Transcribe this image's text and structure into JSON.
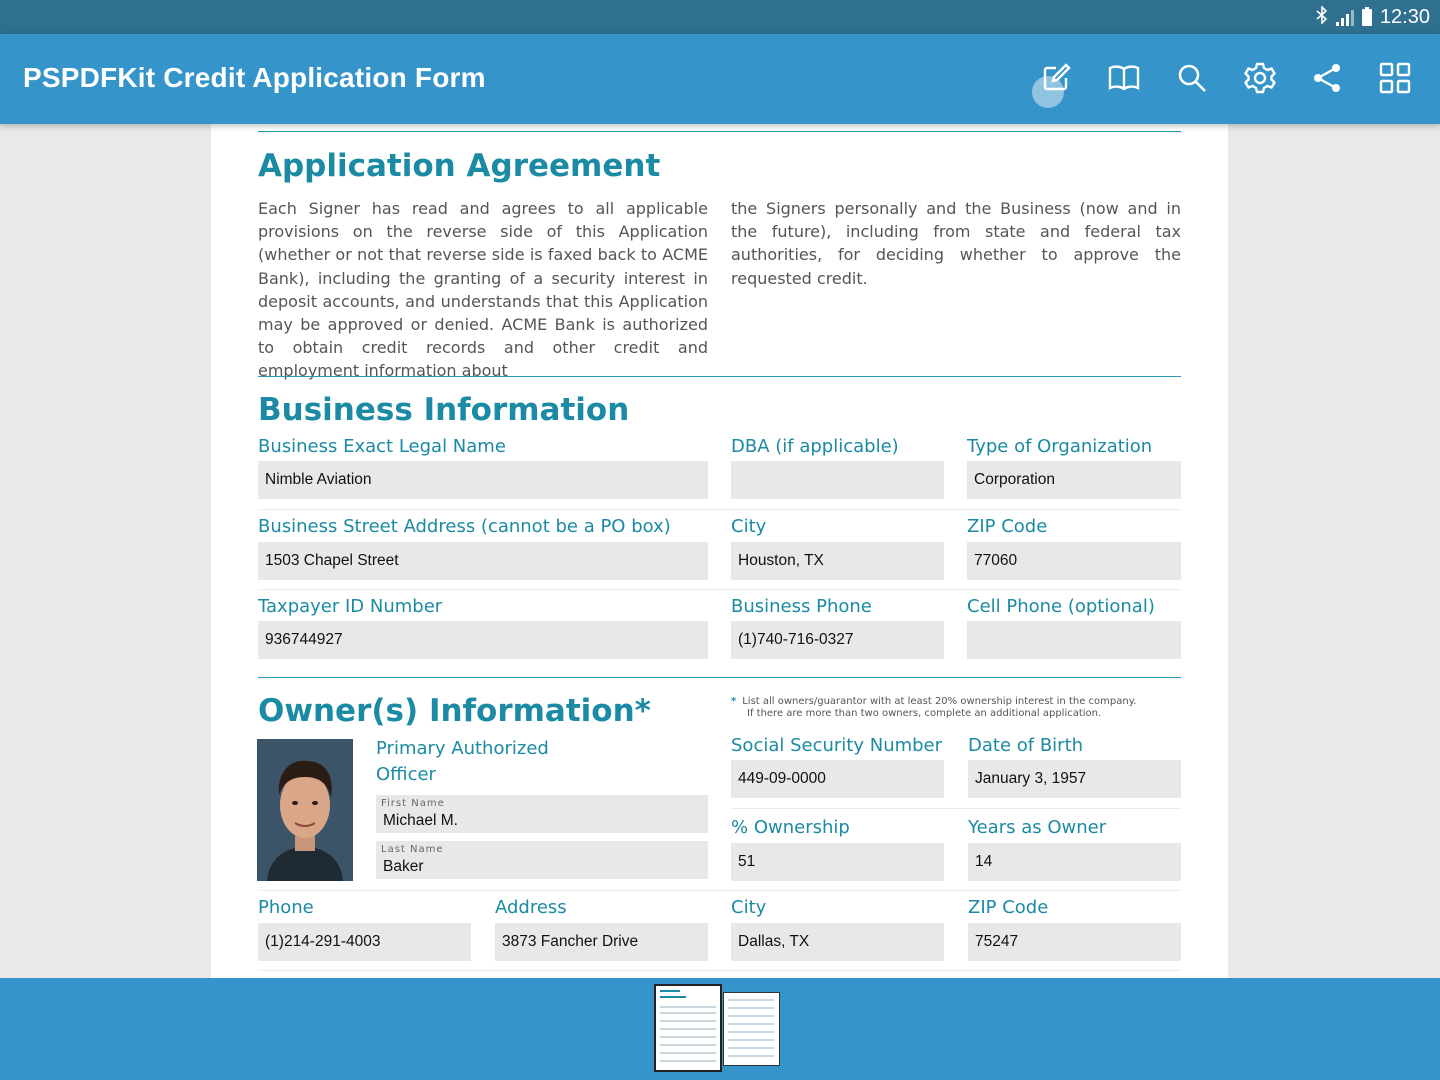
{
  "status_bar": {
    "time": "12:30",
    "icons": [
      "bluetooth-icon",
      "signal-icon",
      "battery-icon"
    ]
  },
  "app_bar": {
    "title": "PSPDFKit Credit Application Form",
    "actions": [
      "annotate-icon",
      "book-outline-icon",
      "search-icon",
      "settings-icon",
      "share-icon",
      "grid-view-icon"
    ]
  },
  "agreement": {
    "heading": "Application Agreement",
    "left_text": "Each Signer has read and agrees to all applicable provisions on the reverse side of this Application (whether or not that reverse side is faxed back to ACME Bank), including the granting of a security interest in deposit accounts, and understands that this Application may be approved or denied. ACME Bank is authorized to obtain credit records and other credit and employment information about",
    "right_text": "the Signers personally and the Business (now and in the future), including from state and federal tax authorities, for deciding whether to approve the requested credit."
  },
  "business": {
    "heading": "Business Information",
    "legal_name_label": "Business Exact Legal Name",
    "legal_name": "Nimble Aviation",
    "dba_label": "DBA (if applicable)",
    "dba": "",
    "org_type_label": "Type of Organization",
    "org_type": "Corporation",
    "address_label": "Business Street Address (cannot be a PO box)",
    "address": "1503 Chapel Street",
    "city_label": "City",
    "city": "Houston, TX",
    "zip_label": "ZIP Code",
    "zip": "77060",
    "taxpayer_label": "Taxpayer ID Number",
    "taxpayer": "936744927",
    "phone_label": "Business Phone",
    "phone": "(1)740-716-0327",
    "cell_label": "Cell Phone (optional)",
    "cell": ""
  },
  "owner": {
    "heading": "Owner(s) Information*",
    "note_star": "*",
    "note_line1": "List all owners/guarantor with at least 20% ownership interest in the company.",
    "note_line2": "If there are more than two owners, complete an additional application.",
    "officer_label_1": "Primary Authorized",
    "officer_label_2": "Officer",
    "first_name_label": "First Name",
    "first_name": "Michael M.",
    "last_name_label": "Last Name",
    "last_name": "Baker",
    "ssn_label": "Social Security Number",
    "ssn": "449-09-0000",
    "dob_label": "Date of Birth",
    "dob": "January 3, 1957",
    "ownership_label": "% Ownership",
    "ownership": "51",
    "years_label": "Years as Owner",
    "years": "14",
    "phone_label": "Phone",
    "phone": "(1)214-291-4003",
    "address_label": "Address",
    "address": "3873 Fancher Drive",
    "city_label": "City",
    "city": "Dallas, TX",
    "zip_label": "ZIP Code",
    "zip": "75247"
  },
  "colors": {
    "app_bar": "#3594c9",
    "status_bar": "#2f6f8f",
    "accent": "#1b8aa4",
    "field_bg": "#e7e8ea"
  }
}
